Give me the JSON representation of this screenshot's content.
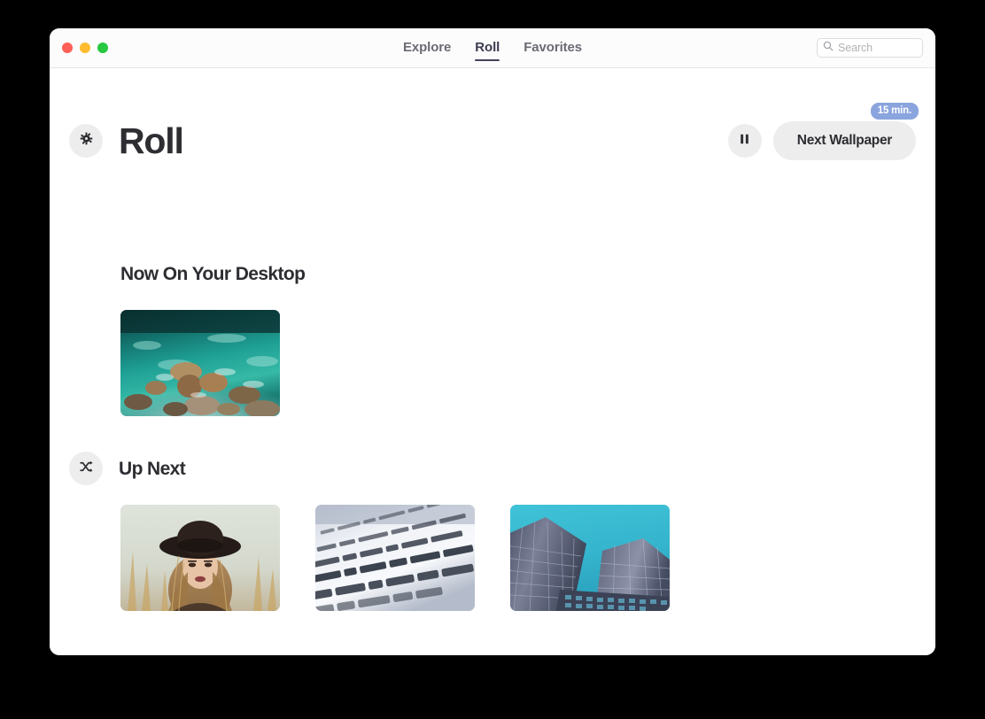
{
  "window": {
    "traffic_lights": [
      {
        "name": "close",
        "color": "#ff5f57"
      },
      {
        "name": "minimize",
        "color": "#febc2e"
      },
      {
        "name": "maximize",
        "color": "#28c840"
      }
    ]
  },
  "titlebar": {
    "tabs": [
      {
        "label": "Explore",
        "active": false
      },
      {
        "label": "Roll",
        "active": true
      },
      {
        "label": "Favorites",
        "active": false
      }
    ],
    "search": {
      "icon": "search-icon",
      "placeholder": "Search",
      "value": ""
    }
  },
  "header": {
    "settings_icon": "gear-icon",
    "title": "Roll",
    "pause_icon": "pause-icon",
    "next_button_label": "Next Wallpaper",
    "timer_badge": "15 min."
  },
  "sections": {
    "desktop": {
      "title": "Now On Your Desktop",
      "items": [
        {
          "name": "aerial-coast-wallpaper",
          "alt": "Aerial view of turquoise ocean water meeting a rocky shoreline"
        }
      ]
    },
    "upnext": {
      "shuffle_icon": "shuffle-icon",
      "title": "Up Next",
      "items": [
        {
          "name": "portrait-hat-wallpaper",
          "alt": "Portrait of a woman wearing a wide-brim black hat among dry grass"
        },
        {
          "name": "book-text-wallpaper",
          "alt": "Macro close-up of French printed text on a curved book page"
        },
        {
          "name": "skyscrapers-wallpaper",
          "alt": "Glass skyscrapers photographed from below against a cyan sky"
        }
      ]
    }
  },
  "colors": {
    "accent_badge": "#8aa4dd",
    "button_bg": "#ededed",
    "text_primary": "#2d2d32",
    "tab_inactive": "#6b6b74",
    "tab_active": "#3b3b52",
    "window_bg": "#ffffff"
  }
}
